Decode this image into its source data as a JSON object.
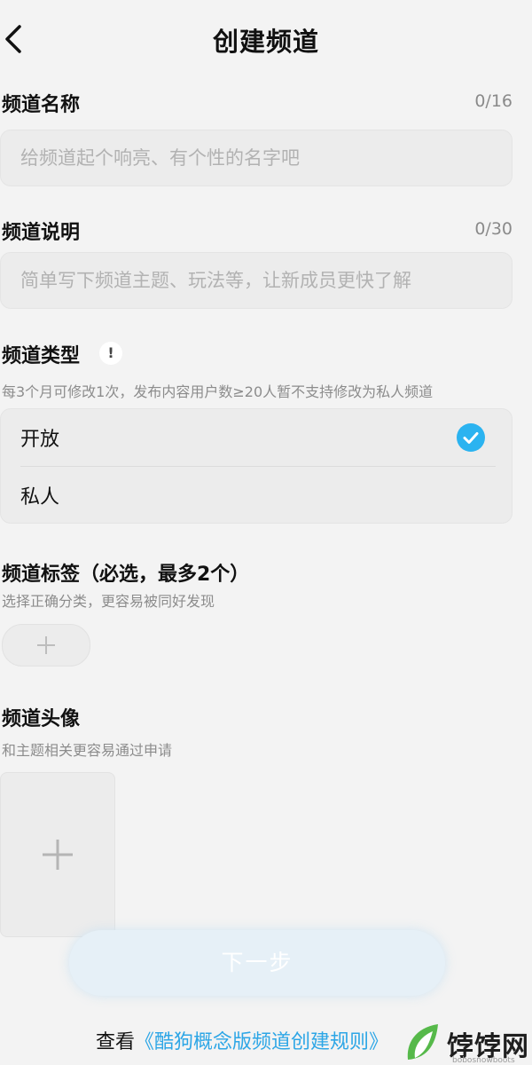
{
  "header": {
    "title": "创建频道",
    "back_icon": "chevron-left-icon"
  },
  "name_section": {
    "label": "频道名称",
    "counter": "0/16",
    "value": "",
    "placeholder": "给频道起个响亮、有个性的名字吧"
  },
  "description_section": {
    "label": "频道说明",
    "counter": "0/30",
    "value": "",
    "placeholder": "简单写下频道主题、玩法等，让新成员更快了解"
  },
  "type_section": {
    "label": "频道类型",
    "info_icon": "exclamation-icon",
    "info_glyph": "!",
    "hint": "每3个月可修改1次，发布内容用户数≥20人暂不支持修改为私人频道",
    "options": [
      {
        "label": "开放",
        "selected": true
      },
      {
        "label": "私人",
        "selected": false
      }
    ],
    "accent_color": "#2bb3f0"
  },
  "tags_section": {
    "label": "频道标签（必选，最多2个）",
    "hint": "选择正确分类，更容易被同好发现",
    "add_icon": "plus-icon"
  },
  "avatar_section": {
    "label": "频道头像",
    "hint": "和主题相关更容易通过申请",
    "upload_icon": "plus-icon"
  },
  "next_button": {
    "label": "下一步",
    "enabled": false
  },
  "rules": {
    "prefix": "查看",
    "link": "《酷狗概念版频道创建规则》",
    "link_color": "#2da6e6"
  },
  "watermark": {
    "text": "饽饽网",
    "subtext": "bobosnowboots"
  }
}
